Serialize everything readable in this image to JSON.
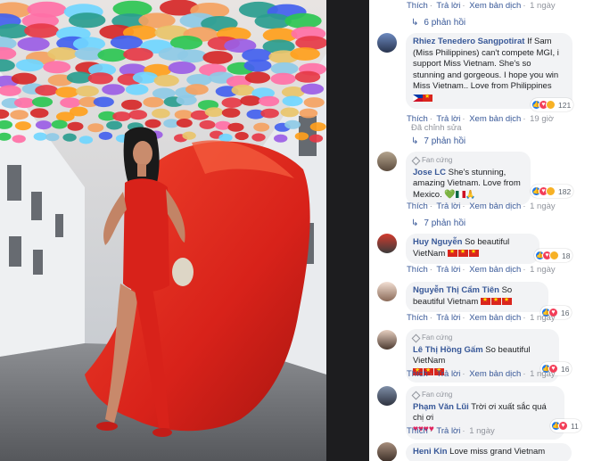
{
  "top": {
    "like": "Thích",
    "reply": "Trả lời",
    "translate": "Xem bản dịch",
    "time": "1 ngày",
    "replies": "6 phản hồi"
  },
  "comments": [
    {
      "author": "Rhiez Tenedero Sangpotirat",
      "text": "If Sam (Miss Philippines) can't compete MGI, i support Miss Vietnam. She's so stunning and gorgeous. I hope you win Miss Vietnam.. Love from Philippines",
      "reaction_count": "121",
      "like": "Thích",
      "reply": "Trả lời",
      "translate": "Xem bản dịch",
      "time": "19 giờ",
      "edited": "Đã chỉnh sửa",
      "replies": "7 phản hồi"
    },
    {
      "badge": "Fan cứng",
      "author": "Jose LC",
      "text": "She's stunning, amazing Vietnam. Love from Mexico.",
      "reaction_count": "182",
      "like": "Thích",
      "reply": "Trả lời",
      "translate": "Xem bản dịch",
      "time": "1 ngày",
      "replies": "7 phản hồi"
    },
    {
      "author": "Huy Nguyễn",
      "text": "So beautiful VietNam",
      "reaction_count": "18",
      "like": "Thích",
      "reply": "Trả lời",
      "translate": "Xem bản dịch",
      "time": "1 ngày"
    },
    {
      "author": "Nguyễn Thị Cẩm Tiên",
      "text": "So beautiful Vietnam",
      "reaction_count": "16",
      "like": "Thích",
      "reply": "Trả lời",
      "translate": "Xem bản dịch",
      "time": "1 ngày"
    },
    {
      "badge": "Fan cứng",
      "author": "Lê Thị Hồng Gấm",
      "text": "So beautiful VietNam",
      "reaction_count": "16",
      "like": "Thích",
      "reply": "Trả lời",
      "translate": "Xem bản dịch",
      "time": "1 ngày"
    },
    {
      "badge": "Fan cứng",
      "author": "Phạm Văn Lũi",
      "text": "Trời ơi xuất sắc quá chị ơi",
      "reaction_count": "11",
      "like": "Thích",
      "reply": "Trả lời",
      "time": "1 ngày"
    },
    {
      "author": "Heni Kin",
      "text": "Love miss grand Vietnam"
    }
  ],
  "icons": {
    "like": "like-icon",
    "love": "love-icon",
    "haha": "haha-icon"
  },
  "colors": {
    "link": "#385898",
    "bubble": "#f2f3f5",
    "dress": "#e0251a"
  }
}
